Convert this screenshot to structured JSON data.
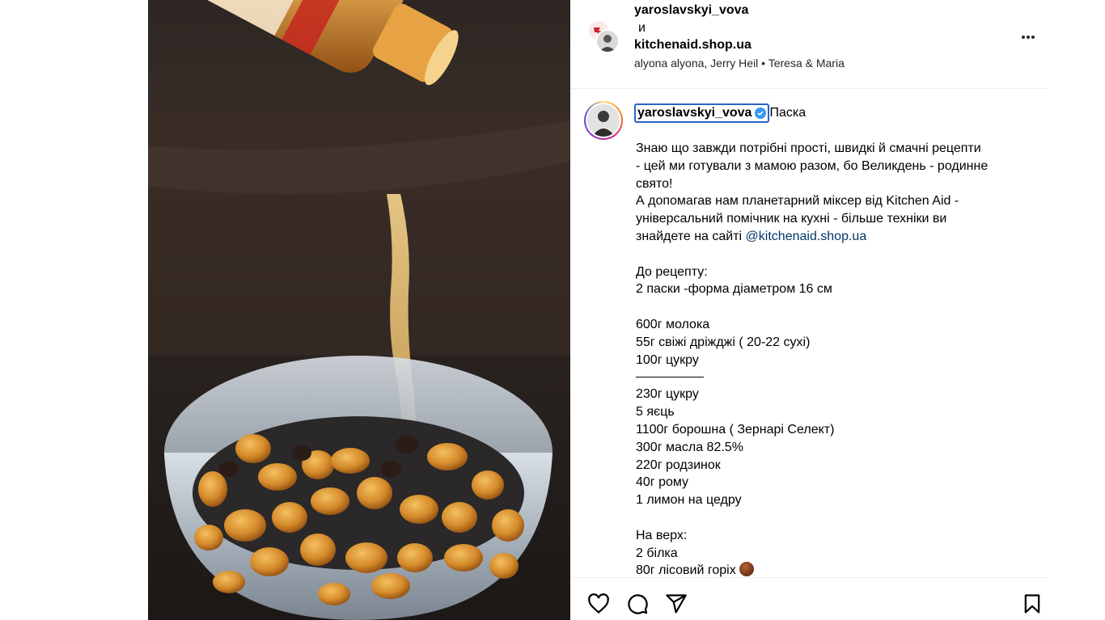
{
  "header": {
    "user1": "yaroslavskyi_vova",
    "conjunction": "и",
    "user2": "kitchenaid.shop.ua",
    "music": "alyona alyona, Jerry Heil • Teresa & Maria"
  },
  "caption": {
    "username": "yaroslavskyi_vova",
    "title": "Паска",
    "lines": [
      "Знаю що завжди потрібні прості, швидкі й смачні рецепти",
      "- цей ми готували з мамою разом, бо Великдень - родинне",
      "свято!",
      "А допомагав нам планетарний міксер від Kitchen Aid -",
      "універсальний помічник на кухні - більше техніки ви"
    ],
    "site_prefix": "знайдете на сайті ",
    "mention": "@kitchenaid.shop.ua",
    "recipe_lines": [
      "До рецепту:",
      "2 паски -форма діаметром 16 см"
    ],
    "ingredients_a": [
      "600г молока",
      "55г свіжі дріжджі ( 20-22 сухі)",
      "100г цукру"
    ],
    "ingredients_b": [
      "230г цукру",
      "5 яєць",
      "1100г борошна ( Зернарі Селект)",
      "300г масла 82.5%",
      "220г родзинок",
      "40г рому",
      "1 лимон на цедру"
    ],
    "topping_title": "На верх:",
    "topping": [
      "2 білка",
      "80г лісовий горіх"
    ]
  },
  "icons": {
    "more": "more-options-icon",
    "verified": "verified-badge-icon",
    "like": "heart-icon",
    "comment": "comment-icon",
    "share": "share-icon",
    "save": "bookmark-icon"
  },
  "colors": {
    "mention": "#00376b",
    "verified": "#3897f0",
    "focus_outline": "#2b62c7"
  }
}
